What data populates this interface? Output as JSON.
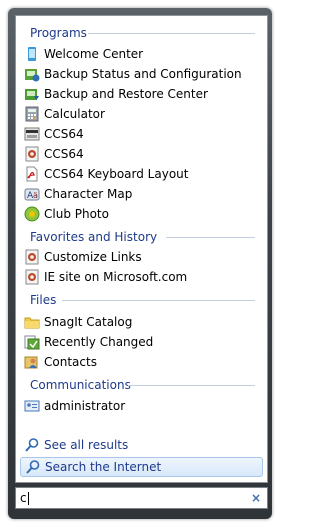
{
  "sections": {
    "programs": {
      "title": "Programs",
      "items": [
        {
          "label": "Welcome Center",
          "icon": "welcome-center-icon"
        },
        {
          "label": "Backup Status and Configuration",
          "icon": "backup-status-icon"
        },
        {
          "label": "Backup and Restore Center",
          "icon": "backup-restore-icon"
        },
        {
          "label": "Calculator",
          "icon": "calculator-icon"
        },
        {
          "label": "CCS64",
          "icon": "ccs64-shortcut-icon"
        },
        {
          "label": "CCS64",
          "icon": "ccs64-document-icon"
        },
        {
          "label": "CCS64 Keyboard Layout",
          "icon": "pdf-icon"
        },
        {
          "label": "Character Map",
          "icon": "character-map-icon"
        },
        {
          "label": "Club Photo",
          "icon": "club-photo-icon"
        }
      ]
    },
    "favorites": {
      "title": "Favorites and History",
      "items": [
        {
          "label": "Customize Links",
          "icon": "ie-link-icon"
        },
        {
          "label": "IE site on Microsoft.com",
          "icon": "ie-link-icon"
        }
      ]
    },
    "files": {
      "title": "Files",
      "items": [
        {
          "label": "SnagIt Catalog",
          "icon": "folder-icon"
        },
        {
          "label": "Recently Changed",
          "icon": "recently-changed-icon"
        },
        {
          "label": "Contacts",
          "icon": "contacts-icon"
        }
      ]
    },
    "communications": {
      "title": "Communications",
      "items": [
        {
          "label": "administrator",
          "icon": "contact-card-icon"
        }
      ]
    }
  },
  "see_all": {
    "label": "See all results",
    "icon": "search-icon"
  },
  "search_internet": {
    "label": "Search the Internet",
    "icon": "search-icon"
  },
  "search_box": {
    "value": "c",
    "clear_icon": "close-icon",
    "clear_glyph": "×"
  },
  "colors": {
    "section_title": "#1e3a8a",
    "frame": "#3c4247",
    "highlight": "#d8e8f9"
  }
}
